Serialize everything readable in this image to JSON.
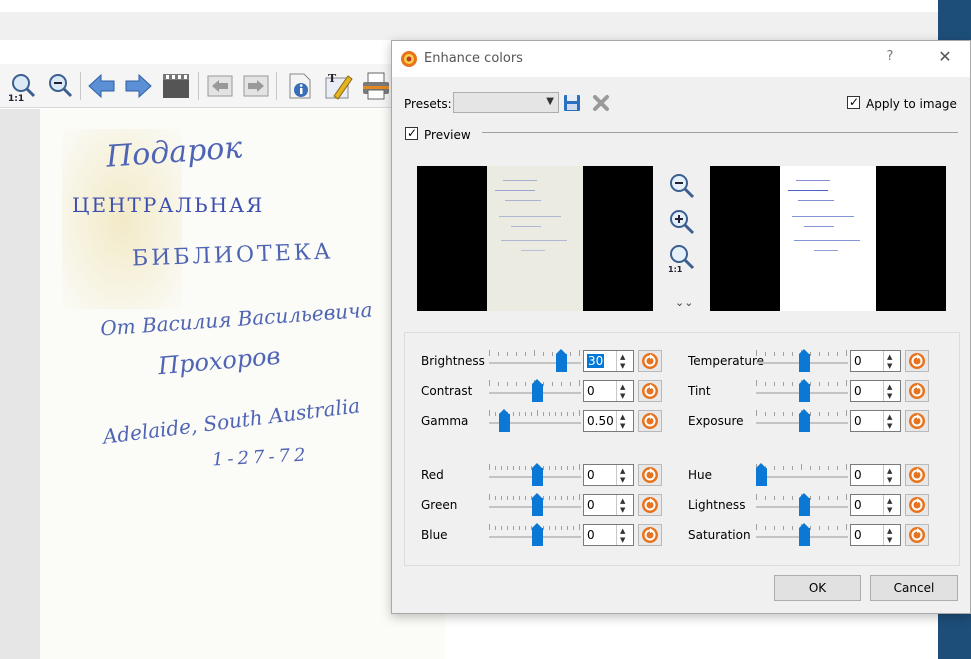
{
  "dialog": {
    "title": "Enhance colors",
    "help_label": "?",
    "close_label": "✕",
    "presets_label": "Presets:",
    "presets_value": "",
    "apply_to_image_label": "Apply to image",
    "apply_to_image_checked": true,
    "preview_label": "Preview",
    "preview_checked": true,
    "expand_label": "⌄⌄",
    "ok_label": "OK",
    "cancel_label": "Cancel"
  },
  "sliders_left": [
    {
      "label": "Brightness",
      "value": "30",
      "position": 0.78,
      "selected": true
    },
    {
      "label": "Contrast",
      "value": "0",
      "position": 0.5
    },
    {
      "label": "Gamma",
      "value": "0.50",
      "position": 0.12
    },
    {
      "label": "Red",
      "value": "0",
      "position": 0.5
    },
    {
      "label": "Green",
      "value": "0",
      "position": 0.5
    },
    {
      "label": "Blue",
      "value": "0",
      "position": 0.5
    }
  ],
  "sliders_right": [
    {
      "label": "Temperature",
      "value": "0",
      "position": 0.5
    },
    {
      "label": "Tint",
      "value": "0",
      "position": 0.5
    },
    {
      "label": "Exposure",
      "value": "0",
      "position": 0.5
    },
    {
      "label": "Hue",
      "value": "0",
      "position": 0.0
    },
    {
      "label": "Lightness",
      "value": "0",
      "position": 0.5
    },
    {
      "label": "Saturation",
      "value": "0",
      "position": 0.5
    }
  ],
  "document": {
    "lines": [
      "Подарок",
      "ЦЕНТРАЛЬНАЯ",
      "БИБЛИОТЕКА",
      "От Василия Васильевича",
      "Прохоров",
      "Adelaide, South Australia",
      "1-27-72"
    ]
  },
  "colors": {
    "accent": "#0a78d4",
    "ink": "#5064b4",
    "right_edge": "#1d4e7a"
  }
}
